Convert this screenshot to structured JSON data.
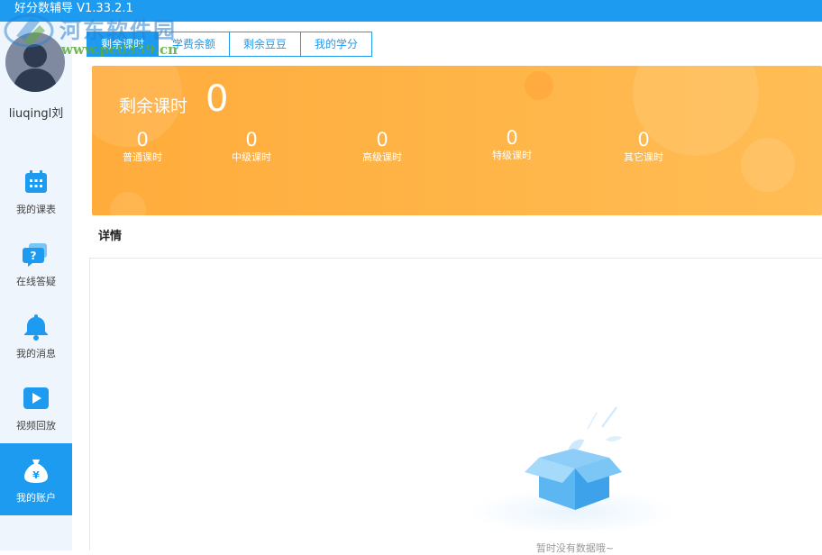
{
  "window": {
    "title": "好分数辅导 V1.33.2.1"
  },
  "watermark": {
    "name": "河东软件园",
    "url": "www.pc0359.cn"
  },
  "user": {
    "name": "liuqingl刘"
  },
  "sidebar": {
    "items": [
      {
        "label": "我的课表",
        "icon": "calendar-icon"
      },
      {
        "label": "在线答疑",
        "icon": "chat-question-icon"
      },
      {
        "label": "我的消息",
        "icon": "bell-icon"
      },
      {
        "label": "视频回放",
        "icon": "play-icon"
      },
      {
        "label": "我的账户",
        "icon": "money-bag-icon",
        "active": true
      }
    ]
  },
  "tabs": [
    {
      "label": "剩余课时",
      "active": true
    },
    {
      "label": "学费余额"
    },
    {
      "label": "剩余豆豆"
    },
    {
      "label": "我的学分"
    }
  ],
  "summary": {
    "title": "剩余课时",
    "total": "0",
    "stats": [
      {
        "value": "0",
        "label": "普通课时"
      },
      {
        "value": "0",
        "label": "中级课时"
      },
      {
        "value": "0",
        "label": "高级课时"
      },
      {
        "value": "0",
        "label": "特级课时"
      },
      {
        "value": "0",
        "label": "其它课时"
      }
    ]
  },
  "detail": {
    "title": "详情",
    "empty_text": "暂时没有数据哦~"
  },
  "colors": {
    "accent": "#1c9bf0",
    "banner": "#ffb040",
    "sidebar_bg": "#eef5fc"
  }
}
